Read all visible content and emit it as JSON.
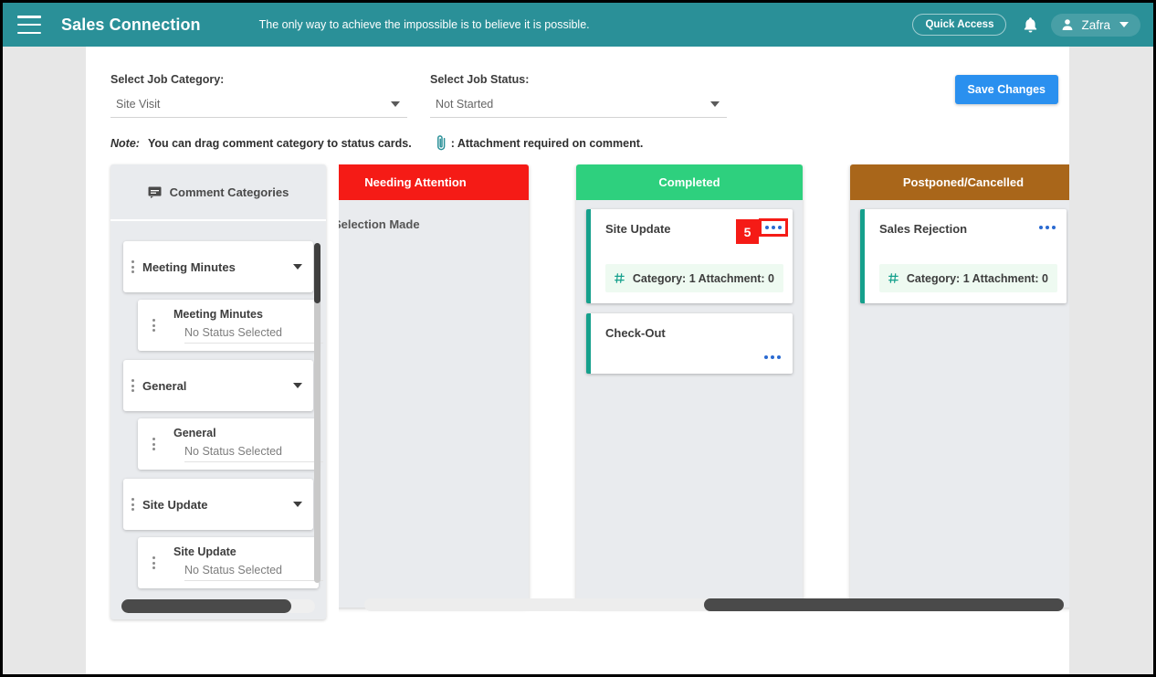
{
  "appbar": {
    "menu_icon": "hamburger-icon",
    "title": "Sales Connection",
    "tagline": "The only way to achieve the impossible is to believe it is possible.",
    "quick_access_label": "Quick Access",
    "bell_icon": "notification-bell-icon",
    "user_icon": "user-avatar-icon",
    "user_name": "Zafra",
    "caret_icon": "chevron-down-icon"
  },
  "filters": {
    "category": {
      "label": "Select Job Category:",
      "value": "Site Visit",
      "arrow_icon": "dropdown-arrow-icon"
    },
    "status": {
      "label": "Select Job Status:",
      "value": "Not Started",
      "arrow_icon": "dropdown-arrow-icon"
    },
    "save_label": "Save Changes"
  },
  "note": {
    "word": "Note:",
    "text": "You can drag comment category to status cards.",
    "clip_icon": "paperclip-icon",
    "text2": ": Attachment required on comment."
  },
  "categories_panel": {
    "icon": "comment-icon",
    "title": "Comment Categories",
    "items": [
      {
        "name": "Meeting Minutes",
        "drag_icon": "drag-handle-icon",
        "caret_icon": "chevron-down-icon",
        "child": {
          "title": "Meeting Minutes",
          "status": "No Status Selected",
          "drag_icon": "drag-handle-icon"
        }
      },
      {
        "name": "General",
        "drag_icon": "drag-handle-icon",
        "caret_icon": "chevron-down-icon",
        "child": {
          "title": "General",
          "status": "No Status Selected",
          "drag_icon": "drag-handle-icon"
        }
      },
      {
        "name": "Site Update",
        "drag_icon": "drag-handle-icon",
        "caret_icon": "chevron-down-icon",
        "child": {
          "title": "Site Update",
          "status": "No Status Selected",
          "drag_icon": "drag-handle-icon"
        }
      }
    ]
  },
  "columns": [
    {
      "title": "Needing Attention",
      "color": "#f51b16",
      "empty_text": "No Selection Made",
      "cards": []
    },
    {
      "title": "Completed",
      "color": "#2ed07e",
      "empty_text": "",
      "cards": [
        {
          "title": "Site Update",
          "menu_icon": "more-options-icon",
          "meta_icon": "hash-icon",
          "meta": "Category: 1 Attachment: 0"
        },
        {
          "title": "Check-Out",
          "menu_icon": "more-options-icon",
          "meta_icon": "",
          "meta": ""
        }
      ]
    },
    {
      "title": "Postponed/Cancelled",
      "color": "#a9661a",
      "empty_text": "",
      "cards": [
        {
          "title": "Sales Rejection",
          "menu_icon": "more-options-icon",
          "meta_icon": "hash-icon",
          "meta": "Category: 1 Attachment: 0"
        }
      ]
    }
  ],
  "annotation": {
    "step_number": "5",
    "highlight_color": "#f51b16"
  },
  "theme": {
    "appbar": "#2a9098",
    "save_button": "#2a90ef",
    "card_accent": "#15a08c",
    "panel_bg": "#e9ebee"
  }
}
